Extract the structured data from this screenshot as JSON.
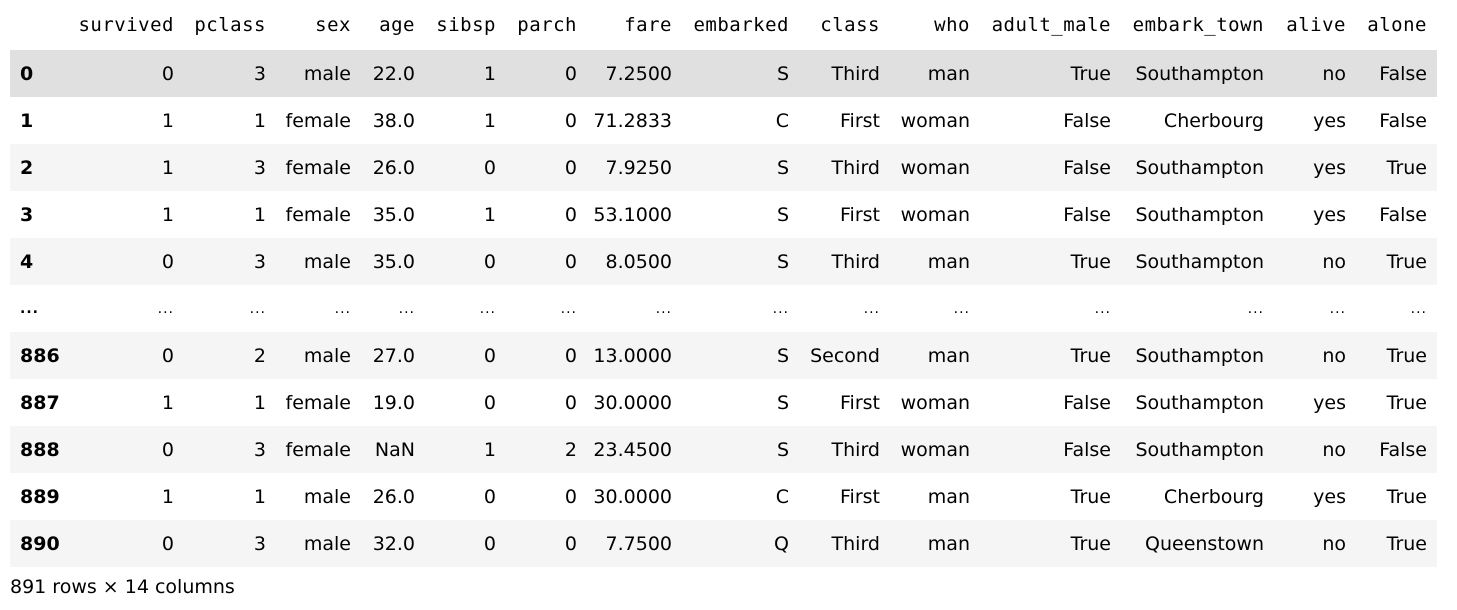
{
  "dataframe": {
    "columns": [
      "survived",
      "pclass",
      "sex",
      "age",
      "sibsp",
      "parch",
      "fare",
      "embarked",
      "class",
      "who",
      "adult_male",
      "embark_town",
      "alive",
      "alone"
    ],
    "rows": [
      {
        "index": "0",
        "cells": [
          "0",
          "3",
          "male",
          "22.0",
          "1",
          "0",
          "7.2500",
          "S",
          "Third",
          "man",
          "True",
          "Southampton",
          "no",
          "False"
        ]
      },
      {
        "index": "1",
        "cells": [
          "1",
          "1",
          "female",
          "38.0",
          "1",
          "0",
          "71.2833",
          "C",
          "First",
          "woman",
          "False",
          "Cherbourg",
          "yes",
          "False"
        ]
      },
      {
        "index": "2",
        "cells": [
          "1",
          "3",
          "female",
          "26.0",
          "0",
          "0",
          "7.9250",
          "S",
          "Third",
          "woman",
          "False",
          "Southampton",
          "yes",
          "True"
        ]
      },
      {
        "index": "3",
        "cells": [
          "1",
          "1",
          "female",
          "35.0",
          "1",
          "0",
          "53.1000",
          "S",
          "First",
          "woman",
          "False",
          "Southampton",
          "yes",
          "False"
        ]
      },
      {
        "index": "4",
        "cells": [
          "0",
          "3",
          "male",
          "35.0",
          "0",
          "0",
          "8.0500",
          "S",
          "Third",
          "man",
          "True",
          "Southampton",
          "no",
          "True"
        ]
      },
      {
        "index": "...",
        "cells": [
          "...",
          "...",
          "...",
          "...",
          "...",
          "...",
          "...",
          "...",
          "...",
          "...",
          "...",
          "...",
          "...",
          "..."
        ]
      },
      {
        "index": "886",
        "cells": [
          "0",
          "2",
          "male",
          "27.0",
          "0",
          "0",
          "13.0000",
          "S",
          "Second",
          "man",
          "True",
          "Southampton",
          "no",
          "True"
        ]
      },
      {
        "index": "887",
        "cells": [
          "1",
          "1",
          "female",
          "19.0",
          "0",
          "0",
          "30.0000",
          "S",
          "First",
          "woman",
          "False",
          "Southampton",
          "yes",
          "True"
        ]
      },
      {
        "index": "888",
        "cells": [
          "0",
          "3",
          "female",
          "NaN",
          "1",
          "2",
          "23.4500",
          "S",
          "Third",
          "woman",
          "False",
          "Southampton",
          "no",
          "False"
        ]
      },
      {
        "index": "889",
        "cells": [
          "1",
          "1",
          "male",
          "26.0",
          "0",
          "0",
          "30.0000",
          "C",
          "First",
          "man",
          "True",
          "Cherbourg",
          "yes",
          "True"
        ]
      },
      {
        "index": "890",
        "cells": [
          "0",
          "3",
          "male",
          "32.0",
          "0",
          "0",
          "7.7500",
          "Q",
          "Third",
          "man",
          "True",
          "Queenstown",
          "no",
          "True"
        ]
      }
    ],
    "hover_row": 0,
    "ellipsis_row": 5
  },
  "footer": {
    "text": "891 rows × 14 columns"
  },
  "colors": {
    "stripe": "#f5f5f5",
    "hover": "#e0e0e0",
    "text": "#000000",
    "background": "#ffffff"
  }
}
